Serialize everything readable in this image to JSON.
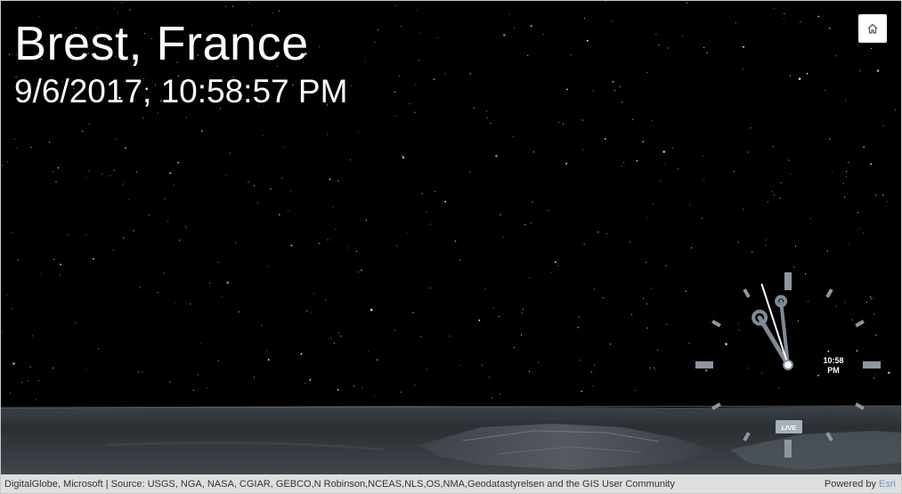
{
  "header": {
    "location": "Brest, France",
    "datetime": "9/6/2017, 10:58:57 PM"
  },
  "controls": {
    "home_icon": "home-icon"
  },
  "clock": {
    "time": "10:58",
    "period": "PM",
    "hour": 10,
    "minute": 58,
    "second": 57,
    "live_label": "LIVE"
  },
  "attribution": {
    "sources": "DigitalGlobe, Microsoft | Source: USGS, NGA, NASA, CGIAR, GEBCO,N Robinson,NCEAS,NLS,OS,NMA,Geodatastyrelsen and the GIS User Community",
    "powered_prefix": "Powered by ",
    "powered_brand": "Esri"
  },
  "colors": {
    "sky": "#000000",
    "text": "#ffffff",
    "clock_hand": "#7e8a96",
    "clock_tick": "#8d97a1",
    "esri_link": "#6e98c9"
  }
}
